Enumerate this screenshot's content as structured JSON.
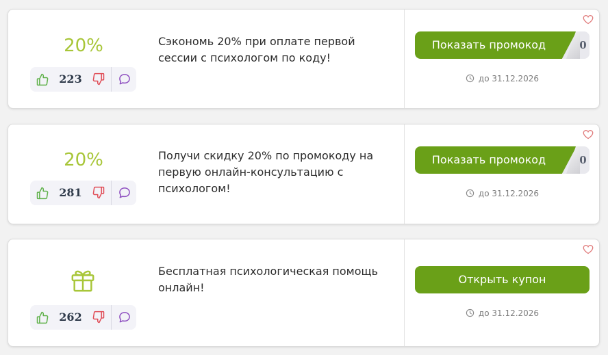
{
  "offers": [
    {
      "discount": "20%",
      "votes": "223",
      "description": "Сэкономь 20% при оплате первой сессии с психологом по коду!",
      "button_label": "Показать промокод",
      "code_hint": "0",
      "expiry": "до 31.12.2026"
    },
    {
      "discount": "20%",
      "votes": "281",
      "description": "Получи скидку 20% по промокоду на первую онлайн-консультацию с психологом!",
      "button_label": "Показать промокод",
      "code_hint": "0",
      "expiry": "до 31.12.2026"
    },
    {
      "icon": "gift-icon",
      "votes": "262",
      "description": "Бесплатная психологическая помощь онлайн!",
      "button_label": "Открыть купон",
      "expiry": "до 31.12.2026"
    }
  ],
  "colors": {
    "accent_green": "#6aa018",
    "discount_green": "#a8c639",
    "thumb_up": "#5fb14a",
    "thumb_down": "#e04b55",
    "comment": "#8e4fc0",
    "heart": "#e07a7a"
  }
}
